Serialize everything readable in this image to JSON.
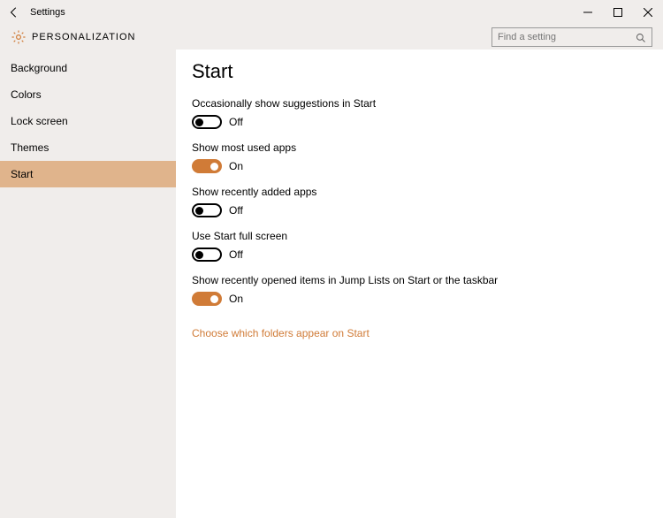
{
  "window": {
    "title": "Settings"
  },
  "header": {
    "section": "PERSONALIZATION",
    "search_placeholder": "Find a setting"
  },
  "sidebar": {
    "items": [
      {
        "label": "Background",
        "selected": false
      },
      {
        "label": "Colors",
        "selected": false
      },
      {
        "label": "Lock screen",
        "selected": false
      },
      {
        "label": "Themes",
        "selected": false
      },
      {
        "label": "Start",
        "selected": true
      }
    ]
  },
  "main": {
    "title": "Start",
    "settings": [
      {
        "label": "Occasionally show suggestions in Start",
        "on": false,
        "state": "Off"
      },
      {
        "label": "Show most used apps",
        "on": true,
        "state": "On"
      },
      {
        "label": "Show recently added apps",
        "on": false,
        "state": "Off"
      },
      {
        "label": "Use Start full screen",
        "on": false,
        "state": "Off"
      },
      {
        "label": "Show recently opened items in Jump Lists on Start or the taskbar",
        "on": true,
        "state": "On"
      }
    ],
    "link": "Choose which folders appear on Start"
  },
  "accent_color": "#d07b37"
}
